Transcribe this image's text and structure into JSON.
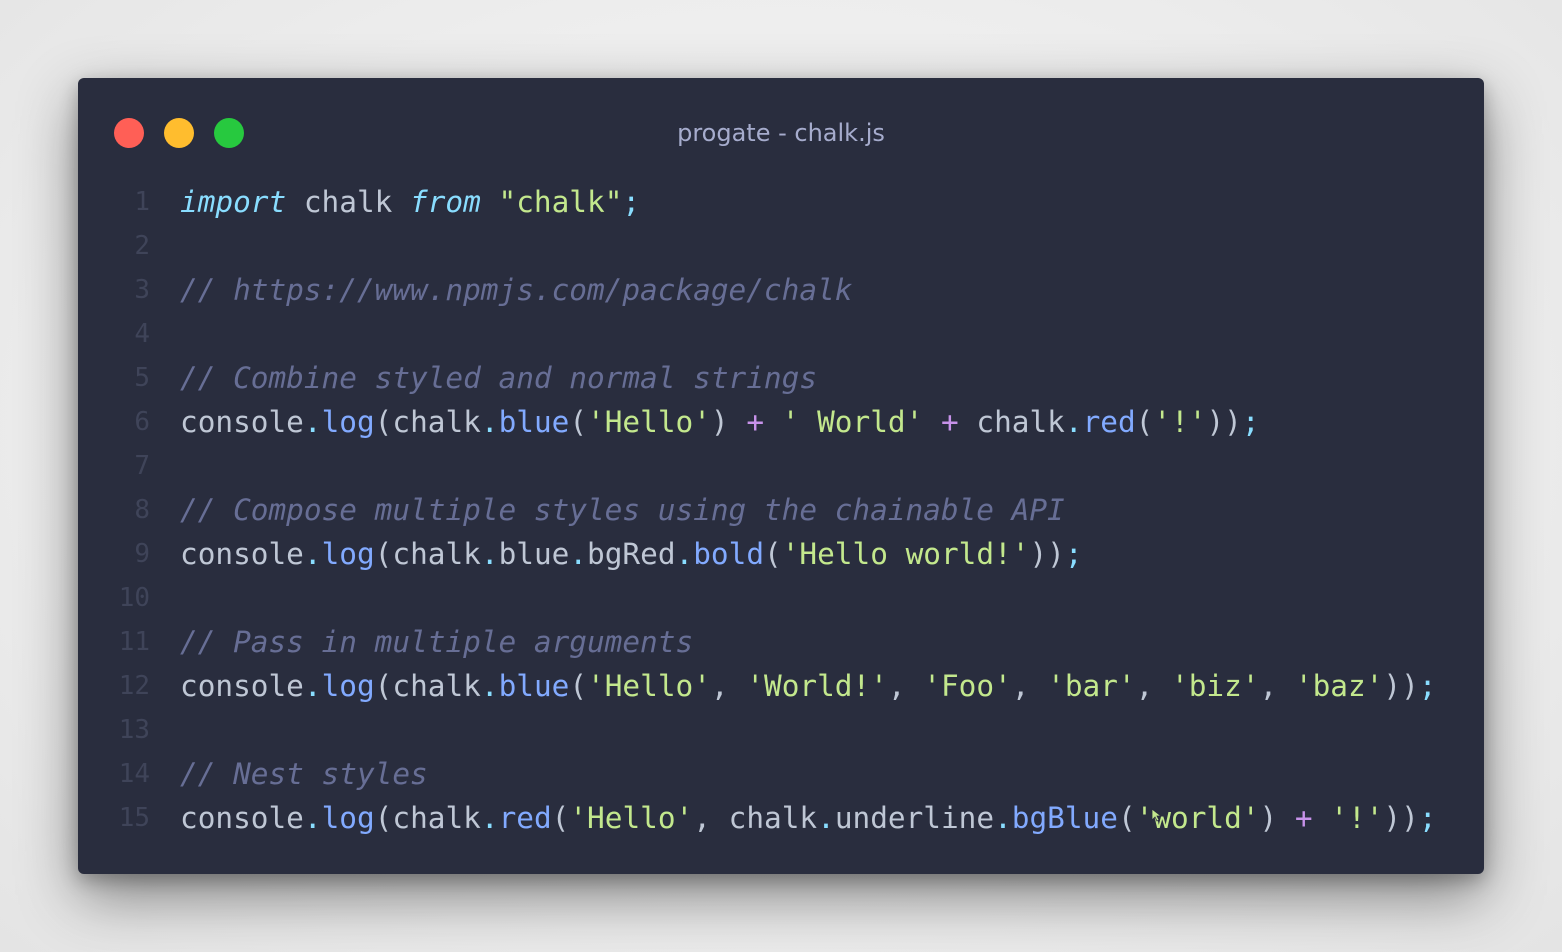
{
  "window": {
    "title": "progate - chalk.js",
    "traffic_lights": {
      "close_color": "#ff5f56",
      "minimize_color": "#ffbd2e",
      "maximize_color": "#27c93f"
    }
  },
  "theme": {
    "background": "#292d3e",
    "keyword": "#89ddff",
    "string": "#c3e88d",
    "comment": "#676e95",
    "function": "#82aaff",
    "operator": "#c792ea",
    "identifier": "#bfc7d5"
  },
  "code": {
    "lines": [
      {
        "n": "1",
        "tokens": [
          {
            "t": "import",
            "c": "kw"
          },
          {
            "t": " chalk ",
            "c": "id"
          },
          {
            "t": "from",
            "c": "kw"
          },
          {
            "t": " ",
            "c": "id"
          },
          {
            "t": "\"chalk\"",
            "c": "str"
          },
          {
            "t": ";",
            "c": "punc"
          }
        ]
      },
      {
        "n": "2",
        "tokens": []
      },
      {
        "n": "3",
        "tokens": [
          {
            "t": "// https://www.npmjs.com/package/chalk",
            "c": "cm"
          }
        ]
      },
      {
        "n": "4",
        "tokens": []
      },
      {
        "n": "5",
        "tokens": [
          {
            "t": "// Combine styled and normal strings",
            "c": "cm"
          }
        ]
      },
      {
        "n": "6",
        "tokens": [
          {
            "t": "console",
            "c": "id"
          },
          {
            "t": ".",
            "c": "punc"
          },
          {
            "t": "log",
            "c": "fn"
          },
          {
            "t": "(",
            "c": "id"
          },
          {
            "t": "chalk",
            "c": "id"
          },
          {
            "t": ".",
            "c": "punc"
          },
          {
            "t": "blue",
            "c": "fn"
          },
          {
            "t": "(",
            "c": "id"
          },
          {
            "t": "'Hello'",
            "c": "str"
          },
          {
            "t": ") ",
            "c": "id"
          },
          {
            "t": "+",
            "c": "op"
          },
          {
            "t": " ",
            "c": "id"
          },
          {
            "t": "' World'",
            "c": "str"
          },
          {
            "t": " ",
            "c": "id"
          },
          {
            "t": "+",
            "c": "op"
          },
          {
            "t": " chalk",
            "c": "id"
          },
          {
            "t": ".",
            "c": "punc"
          },
          {
            "t": "red",
            "c": "fn"
          },
          {
            "t": "(",
            "c": "id"
          },
          {
            "t": "'!'",
            "c": "str"
          },
          {
            "t": "))",
            "c": "id"
          },
          {
            "t": ";",
            "c": "punc"
          }
        ]
      },
      {
        "n": "7",
        "tokens": []
      },
      {
        "n": "8",
        "tokens": [
          {
            "t": "// Compose multiple styles using the chainable API",
            "c": "cm"
          }
        ]
      },
      {
        "n": "9",
        "tokens": [
          {
            "t": "console",
            "c": "id"
          },
          {
            "t": ".",
            "c": "punc"
          },
          {
            "t": "log",
            "c": "fn"
          },
          {
            "t": "(",
            "c": "id"
          },
          {
            "t": "chalk",
            "c": "id"
          },
          {
            "t": ".",
            "c": "punc"
          },
          {
            "t": "blue",
            "c": "id"
          },
          {
            "t": ".",
            "c": "punc"
          },
          {
            "t": "bgRed",
            "c": "id"
          },
          {
            "t": ".",
            "c": "punc"
          },
          {
            "t": "bold",
            "c": "fn"
          },
          {
            "t": "(",
            "c": "id"
          },
          {
            "t": "'Hello world!'",
            "c": "str"
          },
          {
            "t": "))",
            "c": "id"
          },
          {
            "t": ";",
            "c": "punc"
          }
        ]
      },
      {
        "n": "10",
        "tokens": []
      },
      {
        "n": "11",
        "tokens": [
          {
            "t": "// Pass in multiple arguments",
            "c": "cm"
          }
        ]
      },
      {
        "n": "12",
        "tokens": [
          {
            "t": "console",
            "c": "id"
          },
          {
            "t": ".",
            "c": "punc"
          },
          {
            "t": "log",
            "c": "fn"
          },
          {
            "t": "(",
            "c": "id"
          },
          {
            "t": "chalk",
            "c": "id"
          },
          {
            "t": ".",
            "c": "punc"
          },
          {
            "t": "blue",
            "c": "fn"
          },
          {
            "t": "(",
            "c": "id"
          },
          {
            "t": "'Hello'",
            "c": "str"
          },
          {
            "t": ", ",
            "c": "id"
          },
          {
            "t": "'World!'",
            "c": "str"
          },
          {
            "t": ", ",
            "c": "id"
          },
          {
            "t": "'Foo'",
            "c": "str"
          },
          {
            "t": ", ",
            "c": "id"
          },
          {
            "t": "'bar'",
            "c": "str"
          },
          {
            "t": ", ",
            "c": "id"
          },
          {
            "t": "'biz'",
            "c": "str"
          },
          {
            "t": ", ",
            "c": "id"
          },
          {
            "t": "'baz'",
            "c": "str"
          },
          {
            "t": "))",
            "c": "id"
          },
          {
            "t": ";",
            "c": "punc"
          }
        ]
      },
      {
        "n": "13",
        "tokens": []
      },
      {
        "n": "14",
        "tokens": [
          {
            "t": "// Nest styles",
            "c": "cm"
          }
        ]
      },
      {
        "n": "15",
        "tokens": [
          {
            "t": "console",
            "c": "id"
          },
          {
            "t": ".",
            "c": "punc"
          },
          {
            "t": "log",
            "c": "fn"
          },
          {
            "t": "(",
            "c": "id"
          },
          {
            "t": "chalk",
            "c": "id"
          },
          {
            "t": ".",
            "c": "punc"
          },
          {
            "t": "red",
            "c": "fn"
          },
          {
            "t": "(",
            "c": "id"
          },
          {
            "t": "'Hello'",
            "c": "str"
          },
          {
            "t": ", chalk",
            "c": "id"
          },
          {
            "t": ".",
            "c": "punc"
          },
          {
            "t": "underline",
            "c": "id"
          },
          {
            "t": ".",
            "c": "punc"
          },
          {
            "t": "bgBlue",
            "c": "fn"
          },
          {
            "t": "(",
            "c": "id"
          },
          {
            "t": "'world'",
            "c": "str"
          },
          {
            "t": ") ",
            "c": "id"
          },
          {
            "t": "+",
            "c": "op"
          },
          {
            "t": " ",
            "c": "id"
          },
          {
            "t": "'!'",
            "c": "str"
          },
          {
            "t": "))",
            "c": "id"
          },
          {
            "t": ";",
            "c": "punc"
          }
        ]
      }
    ]
  },
  "cursor": {
    "icon": "mouse-pointer-icon"
  }
}
